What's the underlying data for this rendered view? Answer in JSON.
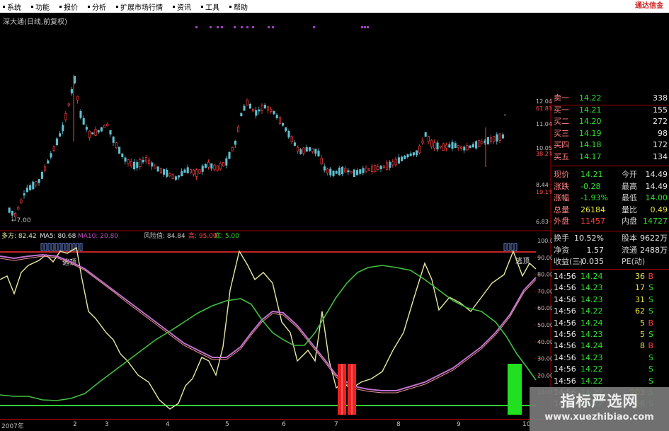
{
  "menu": [
    "系统",
    "功能",
    "报价",
    "分析",
    "扩展市场行情",
    "资讯",
    "工具",
    "帮助"
  ],
  "broker": "通达信金",
  "stock_title": "深大通(日线,前复权)",
  "price_axis": [
    {
      "label": "12.04",
      "color": "#c0c0c0"
    },
    {
      "label": "61.8%",
      "color": "#ff5050"
    },
    {
      "label": "11.04",
      "color": "#c0c0c0"
    },
    {
      "label": "10.05",
      "color": "#c0c0c0"
    },
    {
      "label": "38.2%",
      "color": "#ff5050"
    },
    {
      "label": "8.44",
      "color": "#c0c0c0"
    },
    {
      "label": "19.1%",
      "color": "#ff5050"
    },
    {
      "label": "6.83",
      "color": "#c0c0c0"
    }
  ],
  "low_label": "7.00",
  "indicator_labels": [
    {
      "text": "多方: 82.42",
      "color": "#e8e8a0"
    },
    {
      "text": "MA5: 80.68",
      "color": "#e0e0e0"
    },
    {
      "text": "MA10: 20.80",
      "color": "#c050c0"
    },
    {
      "text": "风险值: 84.84",
      "color": "#c0c0c0"
    },
    {
      "text": "高: 95.00",
      "color": "#ff4040"
    },
    {
      "text": "底: 5.00",
      "color": "#30d030"
    }
  ],
  "ind_axis": [
    "100.0",
    "90.00",
    "80.00",
    "70.00",
    "60.00",
    "50.00",
    "40.00",
    "30.00",
    "20.00",
    "10.00"
  ],
  "annotations": [
    "逃顶",
    "逃顶"
  ],
  "x_axis": {
    "start": "2007年",
    "months": [
      "2",
      "3",
      "4",
      "5",
      "6",
      "7",
      "8",
      "9",
      "10"
    ]
  },
  "order_book": [
    {
      "label": "卖一",
      "price": "14.22",
      "vol": "338"
    },
    {
      "label": "买一",
      "price": "14.21",
      "vol": "155"
    },
    {
      "label": "买二",
      "price": "14.20",
      "vol": "272"
    },
    {
      "label": "买三",
      "price": "14.19",
      "vol": "98"
    },
    {
      "label": "买四",
      "price": "14.18",
      "vol": "172"
    },
    {
      "label": "买五",
      "price": "14.17",
      "vol": "134"
    }
  ],
  "stats": [
    {
      "l1": "现价",
      "v1": "14.21",
      "c1": "grn",
      "l2": "今开",
      "v2": "14.49",
      "c2": "wht"
    },
    {
      "l1": "涨跌",
      "v1": "-0.28",
      "c1": "grn",
      "l2": "最高",
      "v2": "14.49",
      "c2": "wht"
    },
    {
      "l1": "涨幅",
      "v1": "-1.93%",
      "c1": "grn",
      "l2": "最低",
      "v2": "14.00",
      "c2": "grn"
    },
    {
      "l1": "总量",
      "v1": "26184",
      "c1": "yel",
      "l2": "量比",
      "v2": "0.49",
      "c2": "yel"
    },
    {
      "l1": "外盘",
      "v1": "11457",
      "c1": "red",
      "l2": "内盘",
      "v2": "14727",
      "c2": "grn"
    }
  ],
  "stats2": [
    {
      "l1": "换手",
      "v1": "10.52%",
      "l2": "股本",
      "v2": "9622万"
    },
    {
      "l1": "净资",
      "v1": "1.57",
      "l2": "流通",
      "v2": "2488万"
    },
    {
      "l1": "收益(三)",
      "v1": "-0.035",
      "l2": "PE(动)",
      "v2": ""
    }
  ],
  "ticks": [
    {
      "time": "14:56",
      "price": "14.24",
      "vol": "36",
      "side": "B"
    },
    {
      "time": "14:56",
      "price": "14.23",
      "vol": "17",
      "side": "S"
    },
    {
      "time": "14:56",
      "price": "14.23",
      "vol": "31",
      "side": "S"
    },
    {
      "time": "14:56",
      "price": "14.22",
      "vol": "62",
      "side": "S"
    },
    {
      "time": "14:56",
      "price": "14.24",
      "vol": "5",
      "side": "B"
    },
    {
      "time": "14:56",
      "price": "14.23",
      "vol": "5",
      "side": "S"
    },
    {
      "time": "14:56",
      "price": "14.24",
      "vol": "8",
      "side": "B"
    },
    {
      "time": "14:56",
      "price": "14.23",
      "vol": "",
      "side": "S"
    },
    {
      "time": "14:56",
      "price": "14.22",
      "vol": "",
      "side": "S"
    },
    {
      "time": "14:56",
      "price": "14.22",
      "vol": "",
      "side": "S"
    },
    {
      "time": "14:56",
      "price": "14.22",
      "vol": "203",
      "side": "S"
    },
    {
      "time": "14:56",
      "price": "14.22",
      "vol": "66",
      "side": "S"
    }
  ],
  "watermark": {
    "title": "指标严选网",
    "url": "www.xuezhibiao.com"
  },
  "colors": {
    "up": "#ff4040",
    "down": "#60c0d0",
    "grid": "#800000",
    "ma5": "#e8e8a0",
    "ma10": "#c050c0",
    "bottom_line": "#30d030"
  }
}
